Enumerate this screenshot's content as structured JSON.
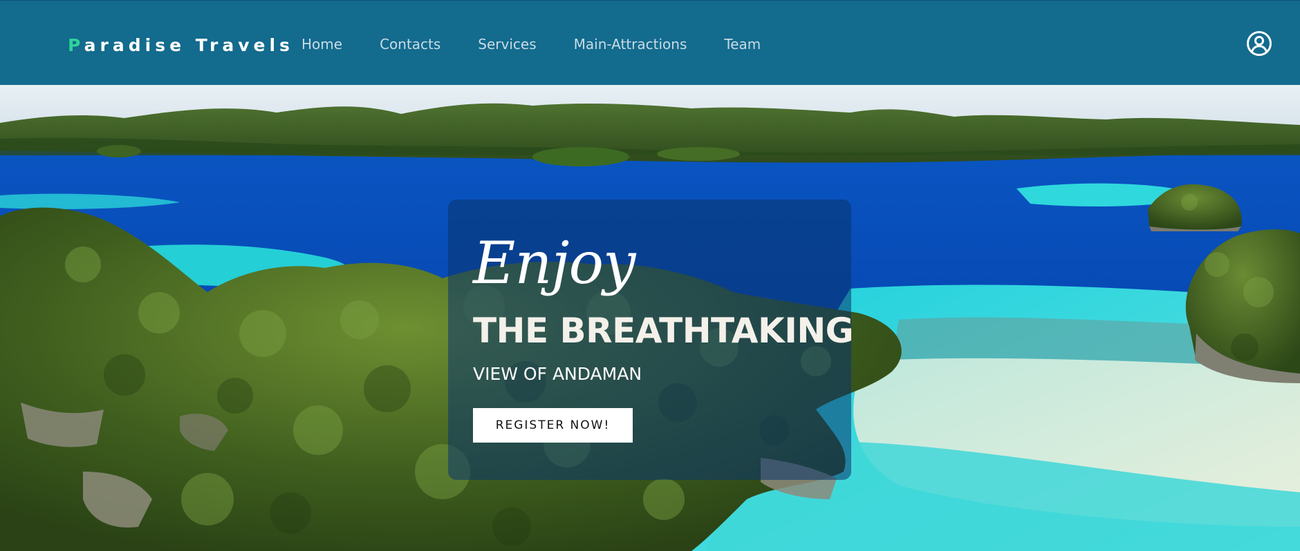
{
  "brand": {
    "first_letter": "P",
    "rest": "aradise Travels"
  },
  "nav": {
    "items": [
      {
        "label": "Home"
      },
      {
        "label": "Contacts"
      },
      {
        "label": "Services"
      },
      {
        "label": "Main-Attractions"
      },
      {
        "label": "Team"
      }
    ]
  },
  "header": {
    "account_icon": "user-circle-icon"
  },
  "hero": {
    "script_text": "Enjoy",
    "title": "THE BREATHTAKING",
    "subtitle": "VIEW OF ANDAMAN",
    "cta_label": "REGISTER NOW!",
    "background": "aerial view of tropical islands, lagoon and turquoise sea"
  },
  "colors": {
    "navbar_bg": "#136b8e",
    "brand_accent": "#2ed39a",
    "nav_text": "#c9dbe4",
    "card_overlay": "rgba(10,52,110,0.55)",
    "button_bg": "#ffffff"
  }
}
